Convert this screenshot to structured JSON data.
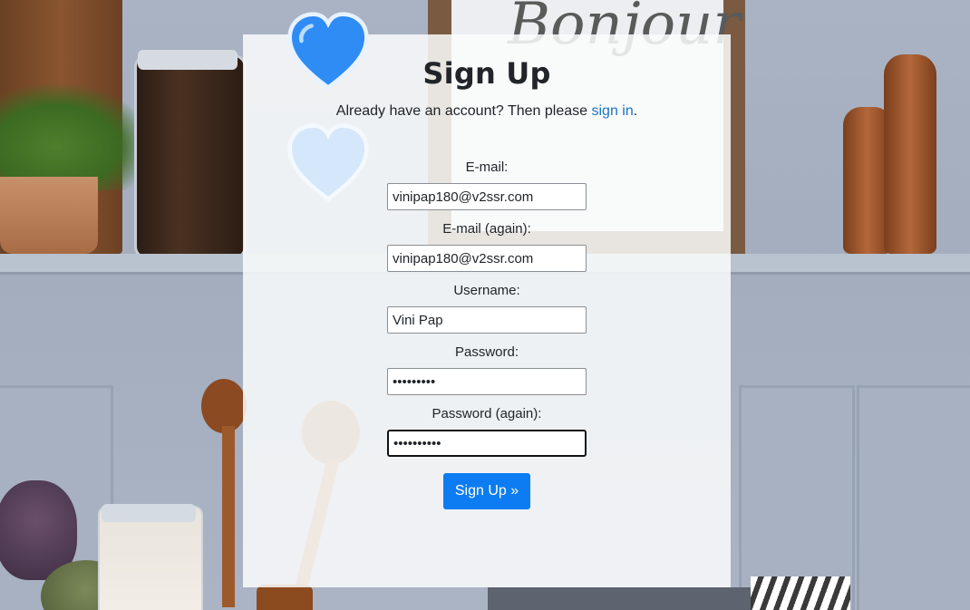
{
  "page": {
    "title": "Sign Up",
    "subtitle_text": "Already have an account? Then please ",
    "signin_link": "sign in",
    "subtitle_end": "."
  },
  "form": {
    "fields": [
      {
        "label": "E-mail:",
        "value": "vinipap180@v2ssr.com",
        "type": "email"
      },
      {
        "label": "E-mail (again):",
        "value": "vinipap180@v2ssr.com",
        "type": "email"
      },
      {
        "label": "Username:",
        "value": "Vini Pap",
        "type": "text"
      },
      {
        "label": "Password:",
        "value": "•••••••••",
        "type": "password"
      },
      {
        "label": "Password (again):",
        "value": "••••••••••",
        "type": "password"
      }
    ],
    "submit_label": "Sign Up »"
  },
  "background": {
    "sign_text": "Bonjour",
    "icons": [
      "blue-heart-sticker",
      "light-blue-heart-sticker"
    ]
  },
  "colors": {
    "accent": "#0d7cf2",
    "link": "#1a73c9",
    "text": "#212529"
  }
}
